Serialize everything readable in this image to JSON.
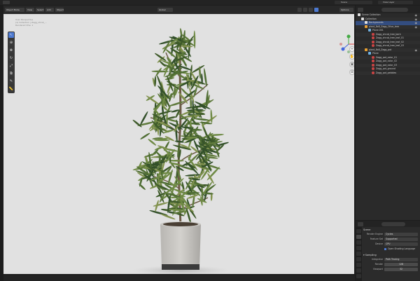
{
  "topbar": {
    "scene": "Scene",
    "view_layer": "View Layer"
  },
  "viewport_header": {
    "mode": "Object Mode",
    "menus": [
      "View",
      "Select",
      "Add",
      "Object"
    ],
    "transform": "Global",
    "options": "Options"
  },
  "viewport_info": {
    "line1": "User Perspective",
    "line2": "(1) Collection | Zagg_shrub_...",
    "line3": "Rendered Ohe: 1"
  },
  "outliner": {
    "title": "Scene Collection",
    "rows": [
      {
        "label": "Scene Collection",
        "indent": 0,
        "icon": "collection",
        "selected": false
      },
      {
        "label": "Collection",
        "indent": 1,
        "icon": "collection",
        "selected": false
      },
      {
        "label": "Backgrounds",
        "indent": 2,
        "icon": "collection",
        "selected": true
      },
      {
        "label": "plant_8x8_Zagg_Olive_tree",
        "indent": 2,
        "icon": "object",
        "selected": false
      },
      {
        "label": "Plane.001",
        "indent": 3,
        "icon": "mesh",
        "selected": false
      },
      {
        "label": "Zagg_shrub_tree_bark",
        "indent": 4,
        "icon": "material",
        "selected": false
      },
      {
        "label": "Zagg_shrub_tree_leaf_01",
        "indent": 4,
        "icon": "material",
        "selected": false
      },
      {
        "label": "Zagg_shrub_tree_leaf_02",
        "indent": 4,
        "icon": "material",
        "selected": false
      },
      {
        "label": "Zagg_shrub_tree_leaf_03",
        "indent": 4,
        "icon": "material",
        "selected": false
      },
      {
        "label": "plant_8x8_Zagg_pot",
        "indent": 2,
        "icon": "object",
        "selected": false
      },
      {
        "label": "Plane",
        "indent": 3,
        "icon": "mesh",
        "selected": false
      },
      {
        "label": "Zagg_pot_color_01",
        "indent": 4,
        "icon": "material",
        "selected": false
      },
      {
        "label": "Zagg_pot_color_02",
        "indent": 4,
        "icon": "material",
        "selected": false
      },
      {
        "label": "Zagg_pot_color_03",
        "indent": 4,
        "icon": "material",
        "selected": false
      },
      {
        "label": "Zagg_pot_ground",
        "indent": 4,
        "icon": "material",
        "selected": false
      },
      {
        "label": "Zagg_pot_pebbles",
        "indent": 4,
        "icon": "material",
        "selected": false
      }
    ]
  },
  "properties": {
    "context": "Scene",
    "render_engine_label": "Render Engine",
    "render_engine": "Cycles",
    "feature_set_label": "Feature Set",
    "feature_set": "Supported",
    "device_label": "Device",
    "device": "CPU",
    "osl_label": "Open Shading Language",
    "sampling_title": "Sampling",
    "integrator_label": "Integrator",
    "integrator": "Path Tracing",
    "render_label": "Render",
    "render_samples": "128",
    "viewport_label": "Viewport",
    "viewport_samples": "32"
  },
  "colors": {
    "accent": "#4d7ad2",
    "viewport_bg": "#e1e1e1",
    "panel_bg": "#2a2a2a",
    "selection": "#334d80"
  }
}
